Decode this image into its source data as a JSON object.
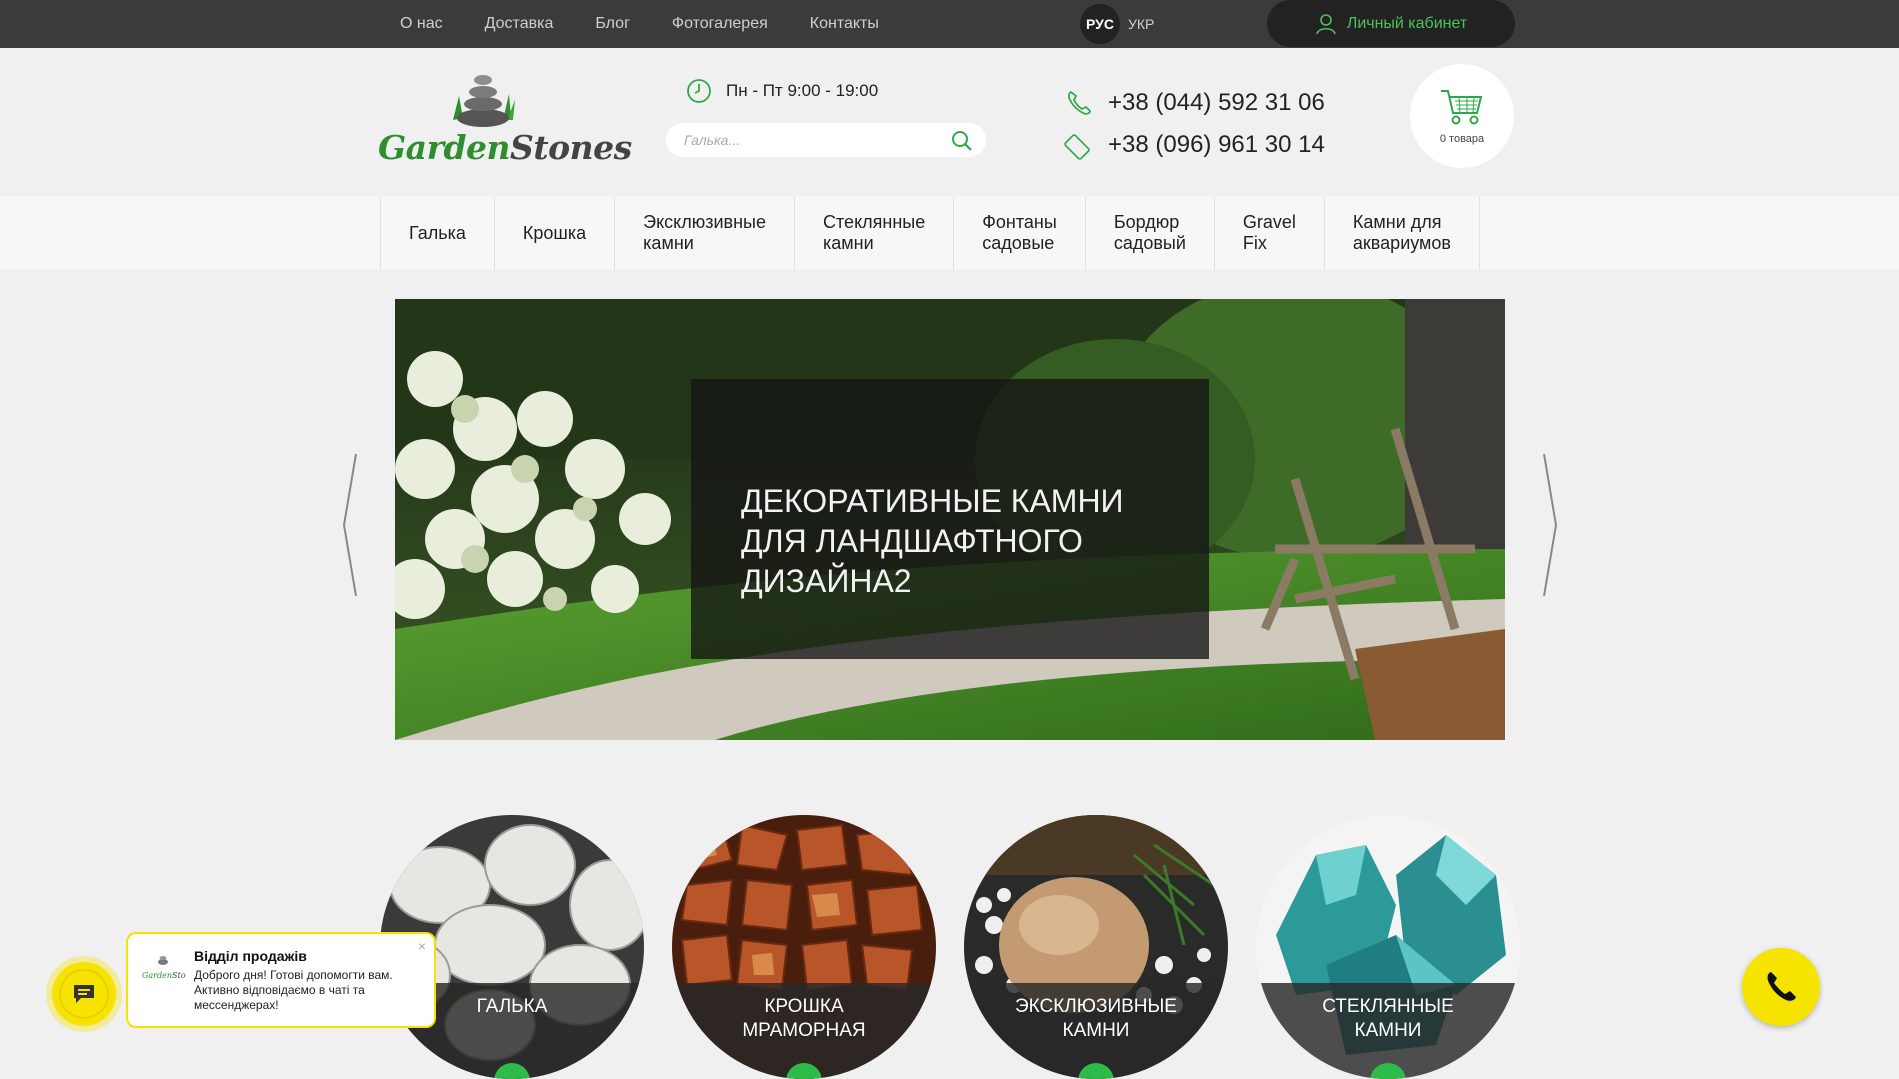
{
  "topnav": {
    "links": [
      "О нас",
      "Доставка",
      "Блог",
      "Фотогалерея",
      "Контакты"
    ],
    "lang_active": "РУС",
    "lang_other": "УКР",
    "cabinet": "Личный кабинет"
  },
  "header": {
    "brand_green": "Garden",
    "brand_gray": "Stones",
    "hours": "Пн - Пт 9:00 - 19:00",
    "search_placeholder": "Галька...",
    "phone1": "+38 (044) 592 31 06",
    "phone2": "+38 (096) 961 30 14",
    "cart_count": "0 товара"
  },
  "categories": [
    "Галька",
    "Крошка",
    "Эксклюзивные\nкамни",
    "Стеклянные\nкамни",
    "Фонтаны\nсадовые",
    "Бордюр\nсадовый",
    "Gravel\nFix",
    "Камни для\nаквариумов"
  ],
  "slider": {
    "caption": "Декоративные камни для ландшафтного дизайна2"
  },
  "tiles": [
    {
      "label": "ГАЛЬКА"
    },
    {
      "label": "КРОШКА\nМРАМОРНАЯ"
    },
    {
      "label": "ЭКСКЛЮЗИВНЫЕ\nКАМНИ"
    },
    {
      "label": "СТЕКЛЯННЫЕ\nКАМНИ"
    }
  ],
  "chat": {
    "title": "Відділ продажів",
    "message": "Доброго дня! Готові допомогти вам. Активно відповідаємо в чаті та мессенджерах!",
    "close": "×"
  },
  "colors": {
    "accent_green": "#4cc15a",
    "topbar": "#3b3b3b",
    "yellow": "#f7e300"
  }
}
